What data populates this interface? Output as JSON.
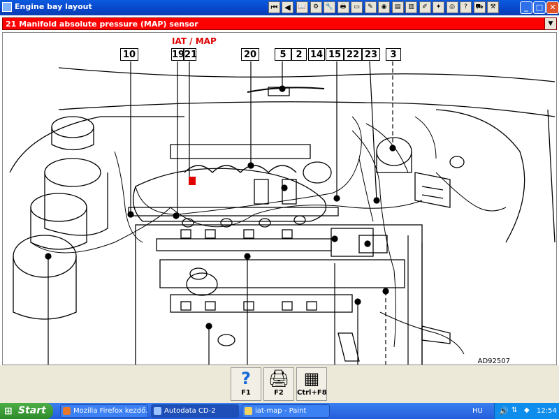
{
  "window": {
    "title": "Engine bay layout",
    "nav_first": "⏮",
    "nav_prev": "◀",
    "minimize": "_",
    "maximize": "□",
    "close": "✕"
  },
  "toolbar_icons": [
    "book-icon",
    "gear-icon",
    "wrench-icon",
    "print-icon",
    "battery-icon",
    "spanner-icon",
    "oil-icon",
    "clipboard-icon",
    "document-icon",
    "edit-icon",
    "bulb-icon",
    "camera-icon",
    "help-icon",
    "car-icon",
    "tool-icon"
  ],
  "component_bar": {
    "label": "21  Manifold absolute pressure (MAP) sensor",
    "dropdown": "▼"
  },
  "diagram": {
    "highlight_label": "IAT  / MAP",
    "callouts": [
      "10",
      "19",
      "21",
      "20",
      "5",
      "2",
      "14",
      "15",
      "22",
      "23",
      "3"
    ],
    "code": "AD92507",
    "highlight_color": "#e00000"
  },
  "fkeys": [
    {
      "label": "F1",
      "icon": "?"
    },
    {
      "label": "F2",
      "icon": "🖨"
    },
    {
      "label": "Ctrl+F8",
      "icon": "▦"
    }
  ],
  "taskbar": {
    "start": "Start",
    "tasks": [
      "Mozilla Firefox kezdő...",
      "Autodata CD-2",
      "iat-map - Paint"
    ],
    "language": "HU",
    "time": "12:54"
  }
}
